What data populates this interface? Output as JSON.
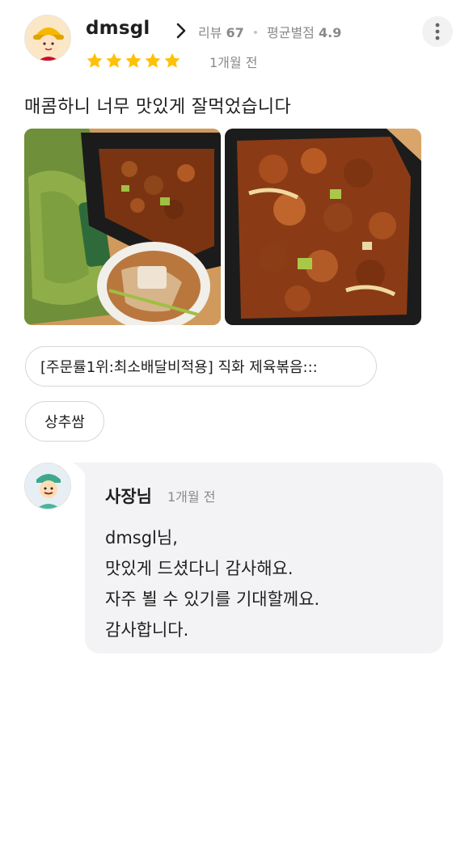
{
  "review": {
    "nickname": "dmsgl",
    "review_label": "리뷰",
    "review_count": "67",
    "rating_label": "평균별점",
    "rating_avg": "4.9",
    "rating": 5,
    "date": "1개월 전",
    "text": "매콤하니 너무 맛있게 잘먹었습니다",
    "photos": [
      "food-photo-1",
      "food-photo-2"
    ],
    "menu_tags": [
      "[주문률1위:최소배달비적용] 직화 제육볶음:::",
      "상추쌈"
    ]
  },
  "reply": {
    "author": "사장님",
    "date": "1개월 전",
    "lines": [
      "dmsgl님,",
      "맛있게 드셨다니 감사해요.",
      "자주 뵐 수 있기를 기대할께요.",
      "감사합니다."
    ]
  },
  "colors": {
    "star": "#ffc107",
    "secondary_text": "#8a8a8a",
    "reply_bg": "#f3f3f5",
    "chip_border": "#d6d6d6"
  },
  "icons": {
    "more": "more-vertical-icon",
    "chevron": "chevron-right-icon",
    "star": "star-icon"
  }
}
